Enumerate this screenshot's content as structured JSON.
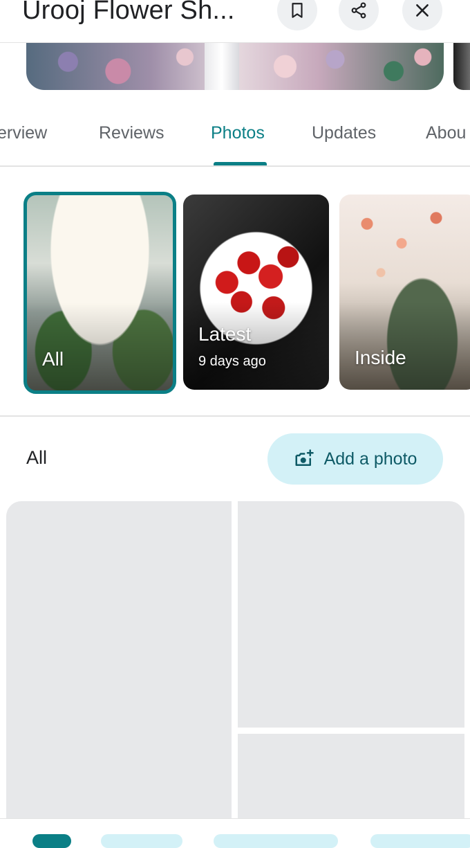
{
  "header": {
    "title": "Urooj Flower Sh...",
    "save_icon": "bookmark-icon",
    "share_icon": "share-icon",
    "close_icon": "close-icon"
  },
  "tabs": [
    {
      "label": "erview"
    },
    {
      "label": "Reviews"
    },
    {
      "label": "Photos",
      "active": true
    },
    {
      "label": "Updates"
    },
    {
      "label": "Abou"
    }
  ],
  "categories": [
    {
      "label": "All",
      "selected": true
    },
    {
      "label": "Latest",
      "sub": "9 days ago"
    },
    {
      "label": "Inside"
    }
  ],
  "photos_section": {
    "heading": "All",
    "add_photo_label": "Add a photo",
    "add_photo_icon": "add-photo-camera-icon"
  },
  "colors": {
    "accent": "#0b7f86",
    "chip_bg": "#d3f1f7",
    "placeholder": "#e7e8ea"
  }
}
